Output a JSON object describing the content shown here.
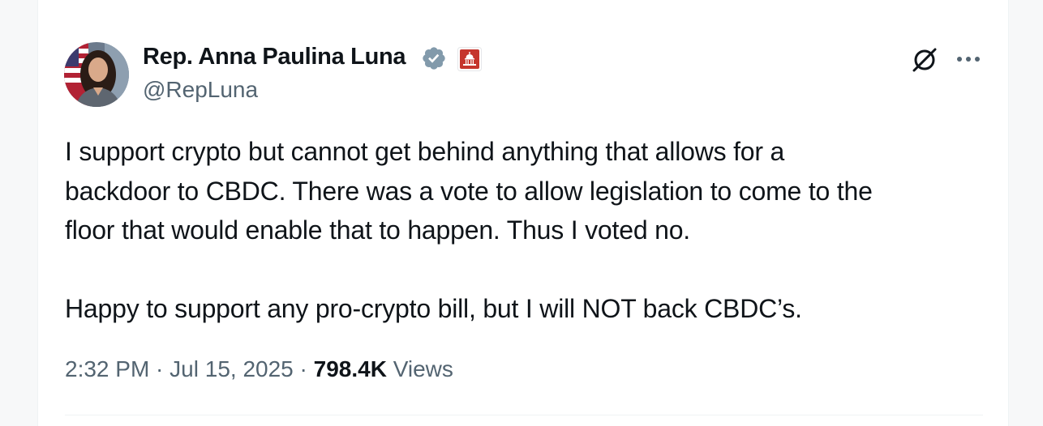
{
  "author": {
    "name": "Rep. Anna Paulina Luna",
    "handle": "@RepLuna"
  },
  "icons": {
    "verified": "verified-badge-icon",
    "affiliation": "capitol-building-icon",
    "grok": "grok-icon",
    "more": "more-options-icon"
  },
  "colors": {
    "verified_badge": "#829aab",
    "affiliation_badge": "#c5352d",
    "text_primary": "#0f1419",
    "text_secondary": "#536471"
  },
  "tweet": {
    "lines": [
      "I support crypto but cannot get behind anything that allows for a",
      "backdoor to CBDC. There was a vote to allow legislation to come to the",
      "floor that would enable that to happen. Thus I voted no.",
      "Happy to support any pro-crypto bill, but I will NOT back CBDC’s."
    ]
  },
  "meta": {
    "time": "2:32 PM",
    "separator": " · ",
    "date": "Jul 15, 2025",
    "views_count": "798.4K",
    "views_label": " Views"
  }
}
